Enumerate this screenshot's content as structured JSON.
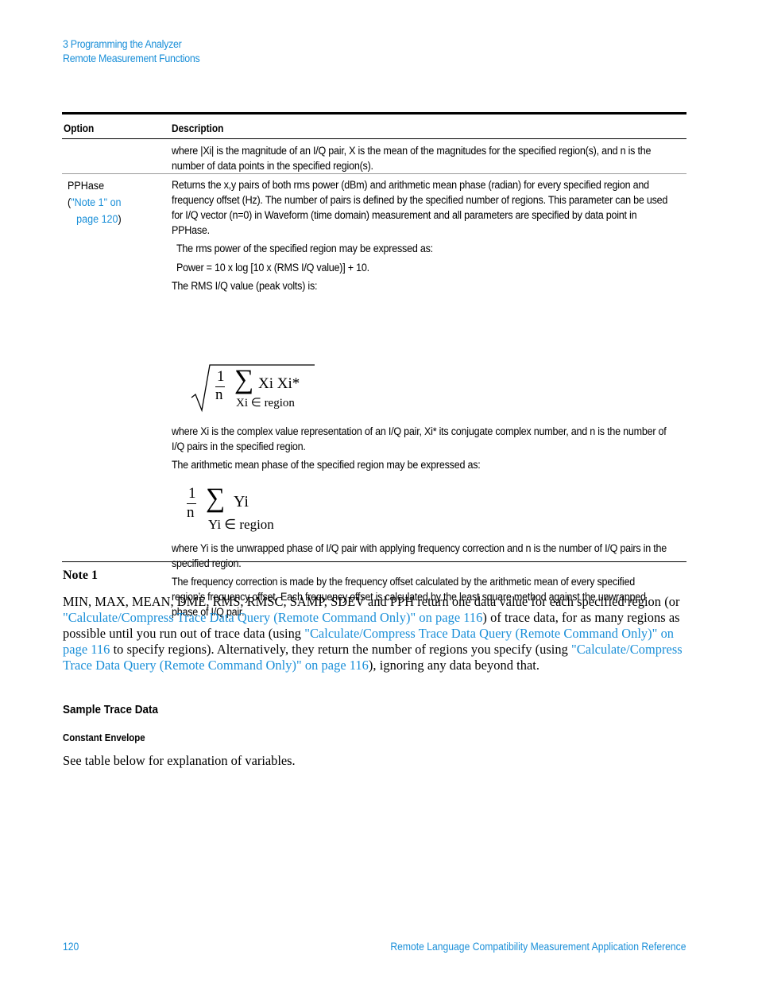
{
  "header": {
    "chapter": "3  Programming the Analyzer",
    "section": "Remote Measurement Functions"
  },
  "table": {
    "columns": [
      "Option",
      "Description"
    ],
    "rows": [
      {
        "option": "",
        "description": "where |Xi| is the magnitude of an I/Q pair, X is the mean of the magnitudes for the specified region(s), and n is the number of data points in the specified region(s)."
      },
      {
        "option": "PPHase",
        "note_link_prefix": "(",
        "note_link_line1": "\"Note 1\" on",
        "note_link_line2": "page 120",
        "note_link_suffix": ")",
        "paragraphs": [
          "Returns the x,y pairs of both rms power (dBm) and arithmetic mean phase (radian) for every specified region and frequency offset (Hz). The number of pairs is defined by the specified number of regions. This parameter can be used for I/Q vector (n=0) in Waveform (time domain) measurement and all parameters are specified by data point in PPHase.",
          "The rms power of the specified region may be expressed as:",
          "Power = 10 x log [10 x (RMS I/Q value)] + 10.",
          "The RMS I/Q value (peak volts) is:",
          "where Xi is the complex value representation of an I/Q pair, Xi* its conjugate complex number, and n is the number of I/Q pairs in the specified region.",
          "The arithmetic mean phase of the specified region may be expressed as:",
          "where Yi is the unwrapped phase of I/Q pair with applying frequency correction and n is the number of I/Q pairs in the specified region.",
          "The frequency correction is made by the frequency offset calculated by the arithmetic mean of every specified region’s frequency offset. Each frequency offset is calculated by the least square method against the unwrapped phase of I/Q pair."
        ],
        "formula1": {
          "num": "1",
          "den": "n",
          "sigma": "∑",
          "term": "Xi Xi*",
          "sub": "Xi ∈  region"
        },
        "formula2": {
          "num": "1",
          "den": "n",
          "sigma": "∑",
          "term": "Yi",
          "sub": "Yi ∈  region"
        }
      }
    ]
  },
  "note1": {
    "title": "Note 1",
    "t1": "MIN, MAX, MEAN, DME, RMS, RMSC, SAMP, SDEV and PPH return one data value for each specified region (or ",
    "link1": "\"Calculate/Compress Trace Data Query (Remote Command Only)\" on page 116",
    "t2": ") of trace data, for as many regions as possible until you run out of trace data (using ",
    "link2": "\"Calculate/Compress Trace Data Query (Remote Command Only)\" on page 116",
    "t3": " to specify regions). Alternatively, they return the number of regions you specify (using ",
    "link3": "\"Calculate/Compress Trace Data Query (Remote Command Only)\" on page 116",
    "t4": "), ignoring any data beyond that."
  },
  "sample": {
    "heading": "Sample Trace Data",
    "subheading": "Constant Envelope",
    "text": "See table below for explanation of variables."
  },
  "footer": {
    "page_number": "120",
    "title": "Remote Language Compatibility Measurement Application Reference"
  }
}
